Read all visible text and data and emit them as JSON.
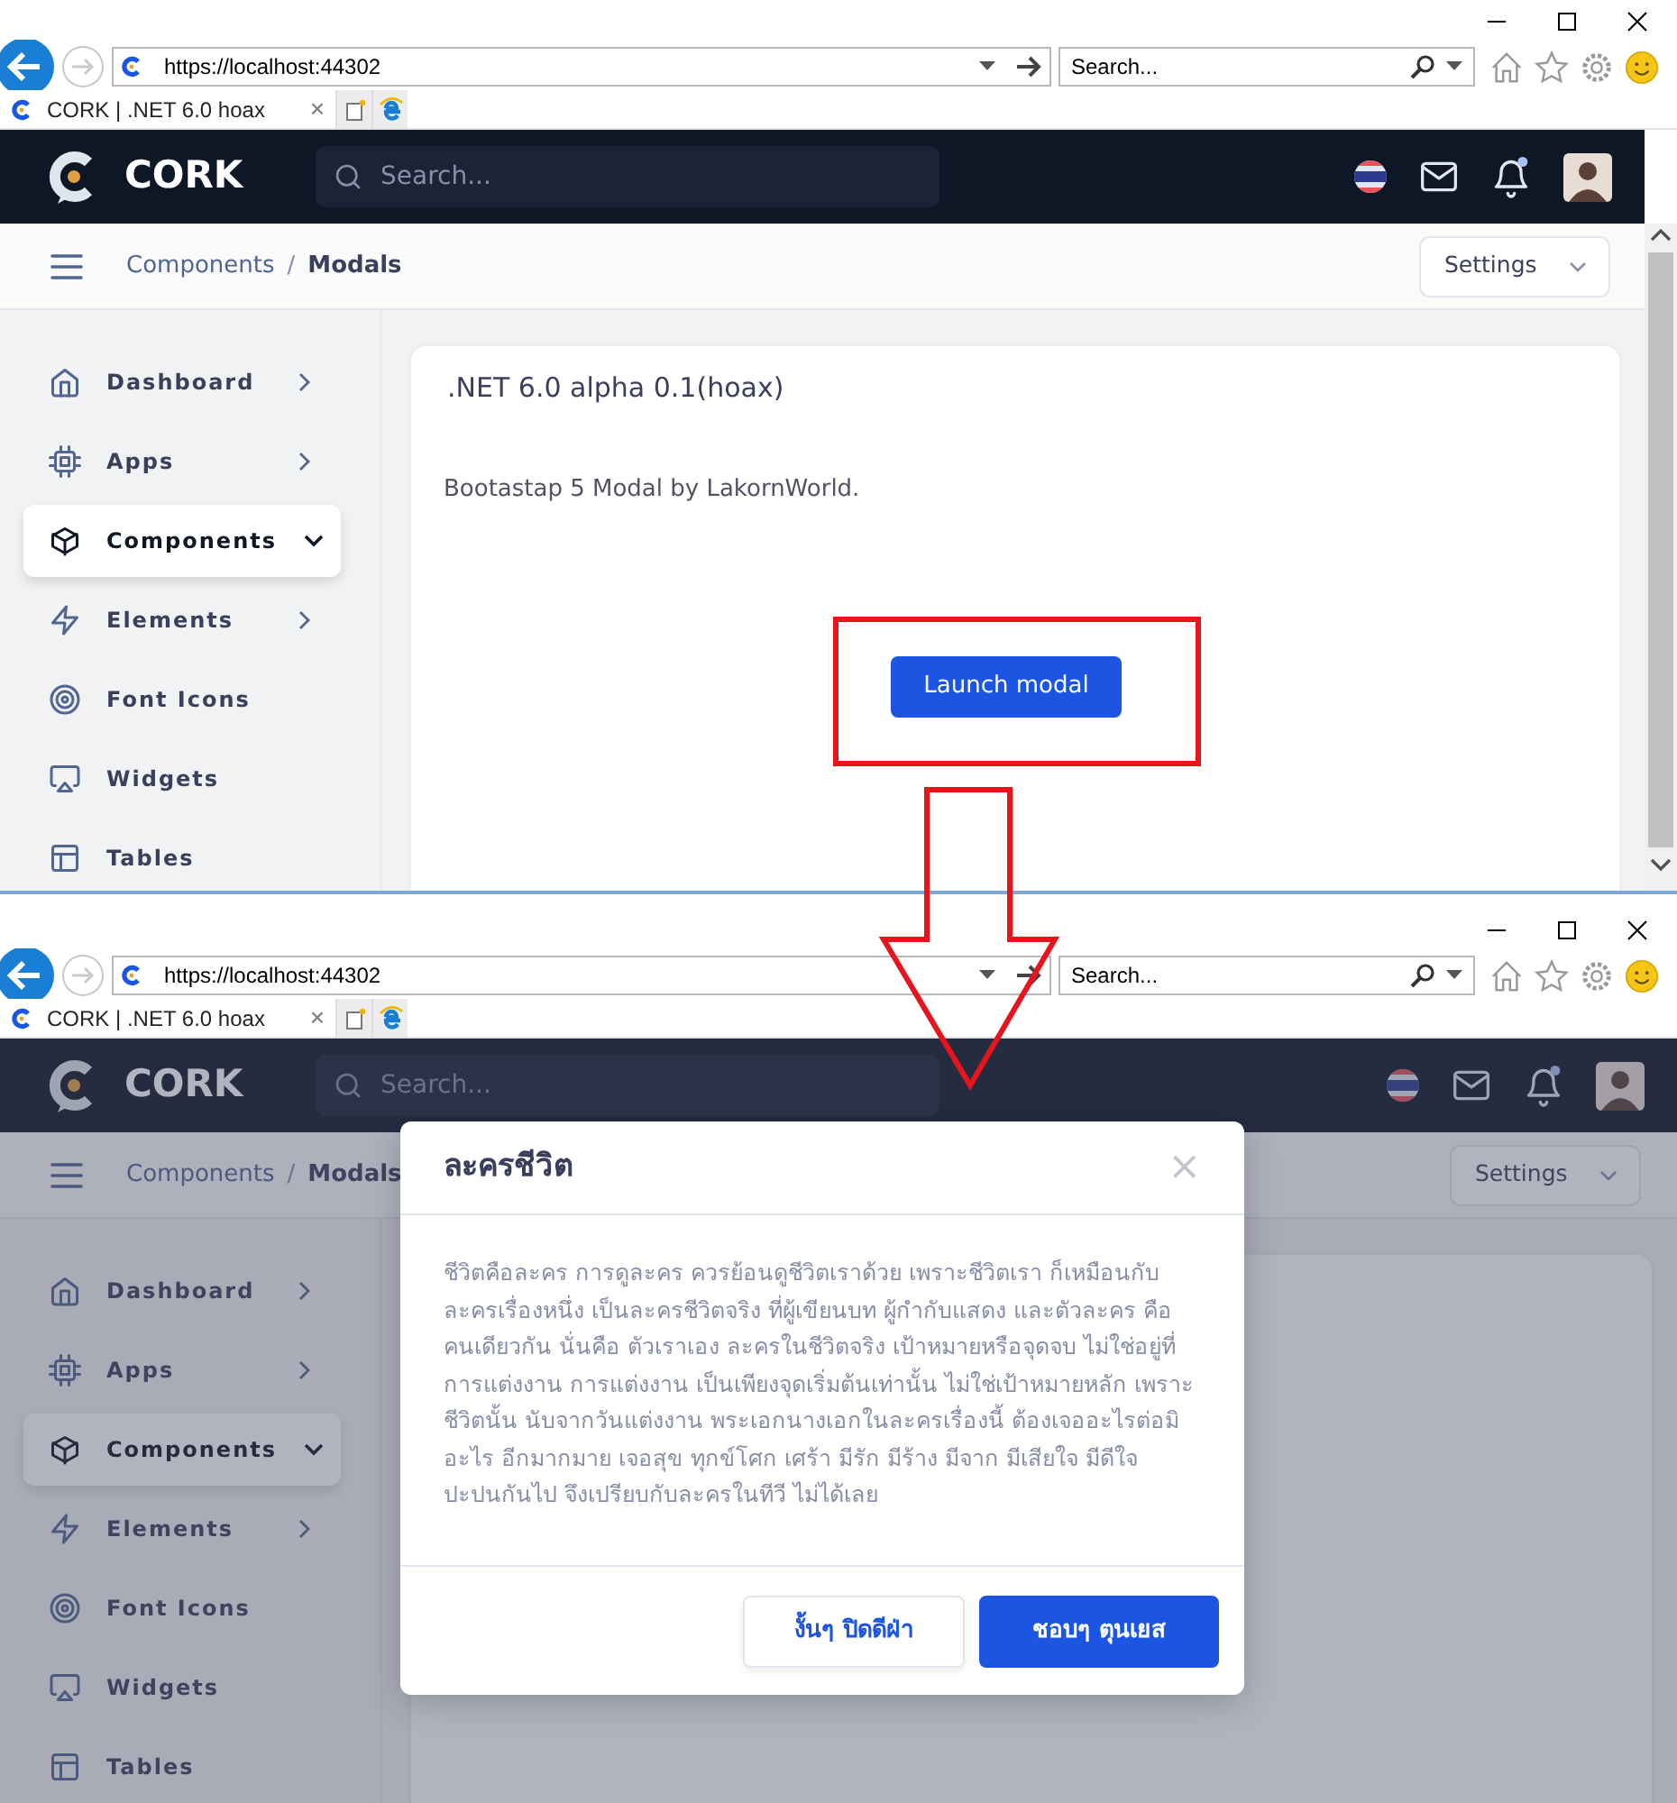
{
  "panels": [
    {
      "scrollbar": true,
      "dimmed": false,
      "browser": {
        "address": "https://localhost:44302",
        "search_placeholder": "Search...",
        "tab_title": "CORK | .NET 6.0 hoax",
        "tab_close": "×"
      },
      "app": {
        "brand": "CORK",
        "search_placeholder": "Search...",
        "breadcrumb": [
          {
            "label": "Components",
            "selected": false
          },
          {
            "label": "Modals",
            "selected": true
          }
        ],
        "breadcrumb_separator": "/",
        "settings": "Settings",
        "sidebar": [
          {
            "label": "Dashboard",
            "expanded": false,
            "selected": false
          },
          {
            "label": "Apps",
            "expanded": false,
            "selected": false
          },
          {
            "label": "Components",
            "expanded": true,
            "selected": true
          },
          {
            "label": "Elements",
            "expanded": false,
            "selected": false
          },
          {
            "label": "Font Icons",
            "selected": false
          },
          {
            "label": "Widgets",
            "selected": false
          },
          {
            "label": "Tables",
            "selected": false
          }
        ],
        "card": {
          "title": ".NET 6.0 alpha 0.1(hoax)",
          "text": "Bootastap 5 Modal by LakornWorld.",
          "button": "Launch modal"
        }
      }
    },
    {
      "scrollbar": false,
      "dimmed": true,
      "browser": {
        "address": "https://localhost:44302",
        "search_placeholder": "Search...",
        "tab_title": "CORK | .NET 6.0 hoax",
        "tab_close": "×"
      },
      "app": {
        "brand": "CORK",
        "search_placeholder": "Search...",
        "breadcrumb": [
          {
            "label": "Components",
            "selected": false
          },
          {
            "label": "Modals",
            "selected": true
          }
        ],
        "breadcrumb_separator": "/",
        "settings": "Settings",
        "sidebar": [
          {
            "label": "Dashboard",
            "expanded": false,
            "selected": false
          },
          {
            "label": "Apps",
            "expanded": false,
            "selected": false
          },
          {
            "label": "Components",
            "expanded": true,
            "selected": true
          },
          {
            "label": "Elements",
            "expanded": false,
            "selected": false
          },
          {
            "label": "Font Icons",
            "selected": false
          },
          {
            "label": "Widgets",
            "selected": false
          },
          {
            "label": "Tables",
            "selected": false
          }
        ]
      },
      "modal": {
        "title": "ละครชีวิต",
        "close": "×",
        "body": "ชีวิตคือละคร การดูละคร ควรย้อนดูชีวิตเราด้วย เพราะชีวิตเรา ก็เหมือนกับละครเรื่องหนึ่ง เป็นละครชีวิตจริง ที่ผู้เขียนบท ผู้กำกับแสดง และตัวละคร คือคนเดียวกัน นั่นคือ ตัวเราเอง ละครในชีวิตจริง เป้าหมายหรือจุดจบ ไม่ใช่อยู่ที่การแต่งงาน การแต่งงาน เป็นเพียงจุดเริ่มต้นเท่านั้น ไม่ใช่เป้าหมายหลัก เพราะชีวิตนั้น นับจากวันแต่งงาน พระเอกนางเอกในละครเรื่องนี้ ต้องเจออะไรต่อมิอะไร อีกมากมาย เจอสุข ทุกข์โศก เศร้า มีรัก มีร้าง มีจาก มีเสียใจ มีดีใจ ปะปนกันไป จึงเปรียบกับละครในทีวี ไม่ได้เลย",
        "buttons": [
          {
            "label": "งั้นๆ ปิดดีฝ่า",
            "kind": "secondary"
          },
          {
            "label": "ชอบๆ ตุนเยส",
            "kind": "primary"
          }
        ]
      }
    }
  ]
}
